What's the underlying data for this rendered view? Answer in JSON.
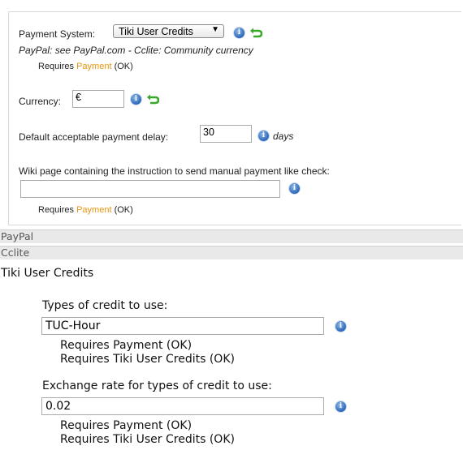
{
  "payment": {
    "system_label": "Payment System:",
    "system_value": "Tiki User Credits",
    "system_hint": "PayPal: see PayPal.com - Cclite: Community currency",
    "requires_prefix": "Requires",
    "requires_link": "Payment",
    "requires_suffix": "(OK)",
    "currency_label": "Currency:",
    "currency_value": "€",
    "delay_label": "Default acceptable payment delay:",
    "delay_value": "30",
    "delay_unit": "days",
    "wiki_label": "Wiki page containing the instruction to send manual payment like check:",
    "wiki_value": "",
    "wiki_requires_prefix": "Requires",
    "wiki_requires_link": "Payment",
    "wiki_requires_suffix": "(OK)"
  },
  "sections": {
    "paypal": "PayPal",
    "cclite": "Cclite",
    "tiki_user_credits": "Tiki User Credits"
  },
  "credits": {
    "types_label": "Types of credit to use:",
    "types_value": "TUC-Hour",
    "types_req1": "Requires Payment (OK)",
    "types_req2": "Requires Tiki User Credits (OK)",
    "rate_label": "Exchange rate for types of credit to use:",
    "rate_value": "0.02",
    "rate_req1": "Requires Payment (OK)",
    "rate_req2": "Requires Tiki User Credits (OK)"
  },
  "icons": {
    "info": "info-icon",
    "reset": "reset-icon"
  }
}
